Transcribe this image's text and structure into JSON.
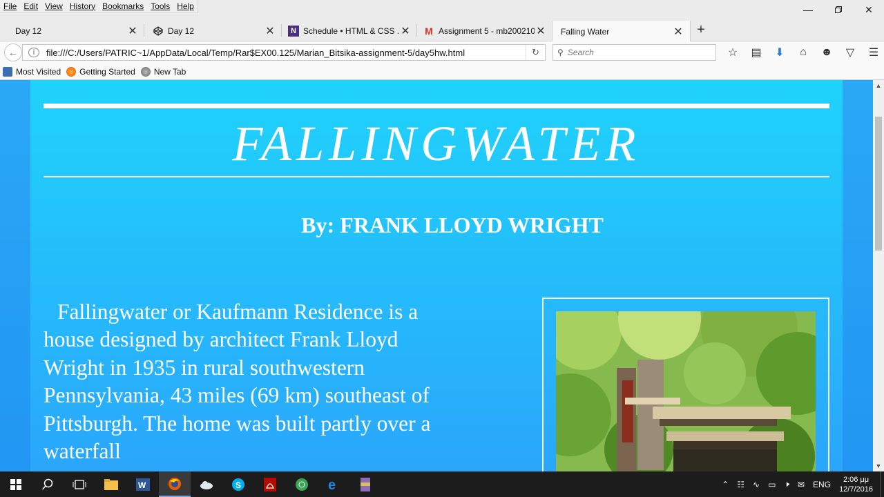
{
  "menu": [
    "File",
    "Edit",
    "View",
    "History",
    "Bookmarks",
    "Tools",
    "Help"
  ],
  "tabs": [
    {
      "label": "Day 12",
      "icon": "blank-page-icon"
    },
    {
      "label": "Day 12",
      "icon": "codepen-icon"
    },
    {
      "label": "Schedule • HTML & CSS ...",
      "icon": "onenote-n-icon"
    },
    {
      "label": "Assignment 5 - mb200210...",
      "icon": "gmail-icon"
    },
    {
      "label": "Falling Water",
      "icon": ""
    }
  ],
  "address": {
    "url": "file:///C:/Users/PATRIC~1/AppData/Local/Temp/Rar$EX00.125/Marian_Bitsika-assignment-5/day5hw.html"
  },
  "search": {
    "placeholder": "Search"
  },
  "bookmarks": [
    "Most Visited",
    "Getting Started",
    "New Tab"
  ],
  "page": {
    "title": "FALLINGWATER",
    "byline": "By: FRANK LLOYD WRIGHT",
    "body": "Fallingwater or Kaufmann Residence is a house designed by architect Frank Lloyd Wright in 1935 in rural southwestern Pennsylvania, 43 miles (69 km) southeast of Pittsburgh. The home was built partly over a waterfall"
  },
  "taskbar": {
    "language": "ENG",
    "time": "2:06 μμ",
    "date": "12/7/2016"
  },
  "colors": {
    "page_top": "#1fd3fb",
    "page_bottom": "#2aa6fb",
    "backdrop": "#2196f3",
    "taskbar": "#1c1c1c"
  }
}
